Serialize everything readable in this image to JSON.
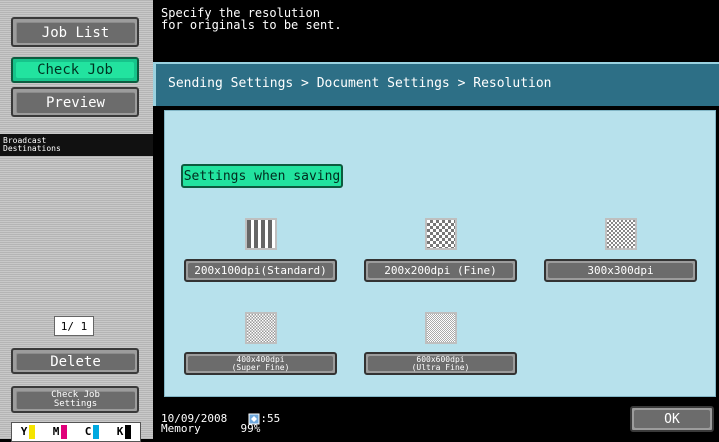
{
  "left": {
    "job_list": "Job List",
    "check_job": "Check Job",
    "preview": "Preview",
    "broadcast_line1": "Broadcast",
    "broadcast_line2": "Destinations",
    "page_indicator": "1/ 1",
    "delete": "Delete",
    "check_job_settings_line1": "Check Job",
    "check_job_settings_line2": "Settings",
    "toner": [
      {
        "label": "Y",
        "color": "#f5e400"
      },
      {
        "label": "M",
        "color": "#e0007a"
      },
      {
        "label": "C",
        "color": "#00a9e0"
      },
      {
        "label": "K",
        "color": "#000000"
      }
    ]
  },
  "message": {
    "line1": "Specify the resolution",
    "line2": "for originals to be sent."
  },
  "breadcrumb": "Sending Settings > Document Settings > Resolution",
  "settings_when_saving": "Settings when saving",
  "resolutions": [
    {
      "label": "200x100dpi(Standard)"
    },
    {
      "label": "200x200dpi (Fine)"
    },
    {
      "label": "300x300dpi"
    },
    {
      "label_line1": "400x400dpi",
      "label_line2": "(Super Fine)"
    },
    {
      "label_line1": "600x600dpi",
      "label_line2": "(Ultra Fine)"
    }
  ],
  "status": {
    "date": "10/09/2008",
    "time": "15:55",
    "memory_label": "Memory",
    "memory_value": "99%"
  },
  "ok": "OK"
}
